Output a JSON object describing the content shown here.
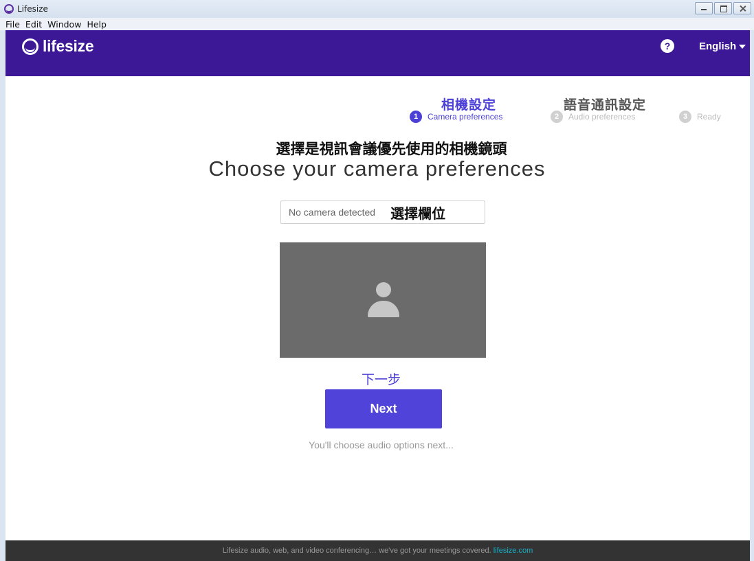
{
  "window": {
    "title": "Lifesize"
  },
  "menu": [
    "File",
    "Edit",
    "Window",
    "Help"
  ],
  "header": {
    "logo_text": "lifesize",
    "help_label": "?",
    "language": "English"
  },
  "steps": [
    {
      "number": "1",
      "cjk": "相機設定",
      "label": "Camera preferences",
      "state": "active"
    },
    {
      "number": "2",
      "cjk": "語音通訊設定",
      "label": "Audio preferences",
      "state": "inactive"
    },
    {
      "number": "3",
      "cjk": "",
      "label": "Ready",
      "state": "inactive"
    }
  ],
  "main": {
    "cjk_heading": "選擇是視訊會議優先使用的相機鏡頭",
    "title": "Choose your camera preferences",
    "camera_select_value": "No camera detected",
    "camera_select_cjk": "選擇欄位",
    "next_cjk": "下一步",
    "next_button": "Next",
    "hint": "You'll choose audio options next..."
  },
  "footer": {
    "text": "Lifesize audio, web, and video conferencing… we've got your meetings covered.",
    "link": "lifesize.com"
  },
  "colors": {
    "header_bg": "#3c1896",
    "accent": "#4f43d9",
    "footer_bg": "#333333",
    "link": "#16b2c8"
  }
}
